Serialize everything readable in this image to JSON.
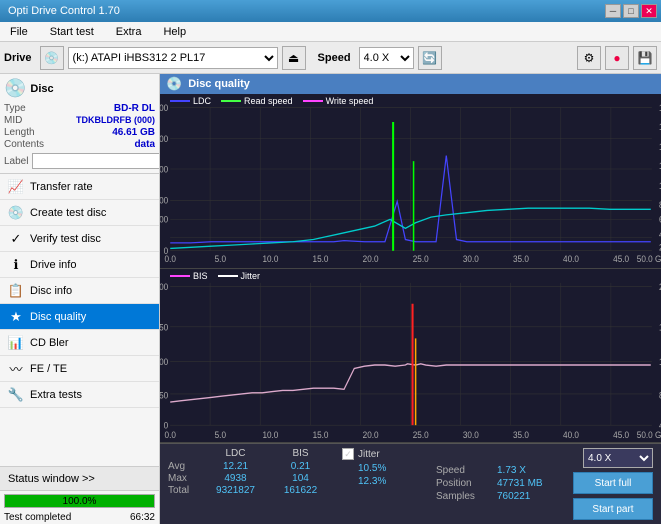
{
  "app": {
    "title": "Opti Drive Control 1.70",
    "icon": "💿"
  },
  "titlebar": {
    "minimize": "─",
    "maximize": "□",
    "close": "✕"
  },
  "menu": {
    "items": [
      "File",
      "Start test",
      "Extra",
      "Help"
    ]
  },
  "toolbar": {
    "drive_label": "Drive",
    "drive_value": "(k:) ATAPI iHBS312  2 PL17",
    "speed_label": "Speed",
    "speed_value": "4.0 X"
  },
  "disc": {
    "title": "Disc",
    "type_label": "Type",
    "type_value": "BD-R DL",
    "mid_label": "MID",
    "mid_value": "TDKBLDRFB (000)",
    "length_label": "Length",
    "length_value": "46.61 GB",
    "contents_label": "Contents",
    "contents_value": "data",
    "label_label": "Label",
    "label_value": ""
  },
  "nav": {
    "items": [
      {
        "id": "transfer-rate",
        "label": "Transfer rate",
        "icon": "📈",
        "active": false
      },
      {
        "id": "create-test-disc",
        "label": "Create test disc",
        "icon": "💿",
        "active": false
      },
      {
        "id": "verify-test-disc",
        "label": "Verify test disc",
        "icon": "✓",
        "active": false
      },
      {
        "id": "drive-info",
        "label": "Drive info",
        "icon": "ℹ",
        "active": false
      },
      {
        "id": "disc-info",
        "label": "Disc info",
        "icon": "📋",
        "active": false
      },
      {
        "id": "disc-quality",
        "label": "Disc quality",
        "icon": "★",
        "active": true
      },
      {
        "id": "cd-bler",
        "label": "CD Bler",
        "icon": "📊",
        "active": false
      },
      {
        "id": "fe-te",
        "label": "FE / TE",
        "icon": "〰",
        "active": false
      },
      {
        "id": "extra-tests",
        "label": "Extra tests",
        "icon": "🔧",
        "active": false
      }
    ]
  },
  "status": {
    "window_label": "Status window >>",
    "progress_value": 100,
    "progress_text": "100.0%",
    "status_text": "Test completed",
    "time_value": "66:32"
  },
  "disc_quality": {
    "title": "Disc quality",
    "legend": {
      "ldc_label": "LDC",
      "ldc_color": "#4444ff",
      "read_speed_label": "Read speed",
      "read_speed_color": "#44ff44",
      "write_speed_label": "Write speed",
      "write_speed_color": "#ff44ff"
    },
    "legend2": {
      "bis_label": "BIS",
      "bis_color": "#ff44ff",
      "jitter_label": "Jitter",
      "jitter_color": "#ffffff"
    },
    "stats": {
      "ldc_title": "LDC",
      "bis_title": "BIS",
      "jitter_title": "Jitter",
      "avg_label": "Avg",
      "max_label": "Max",
      "total_label": "Total",
      "ldc_avg": "12.21",
      "ldc_max": "4938",
      "ldc_total": "9321827",
      "bis_avg": "0.21",
      "bis_max": "104",
      "bis_total": "161622",
      "jitter_avg": "10.5%",
      "jitter_max": "12.3%",
      "speed_label": "Speed",
      "speed_value": "1.73 X",
      "position_label": "Position",
      "position_value": "47731 MB",
      "samples_label": "Samples",
      "samples_value": "760221",
      "speed_select": "4.0 X",
      "start_full": "Start full",
      "start_part": "Start part"
    }
  }
}
